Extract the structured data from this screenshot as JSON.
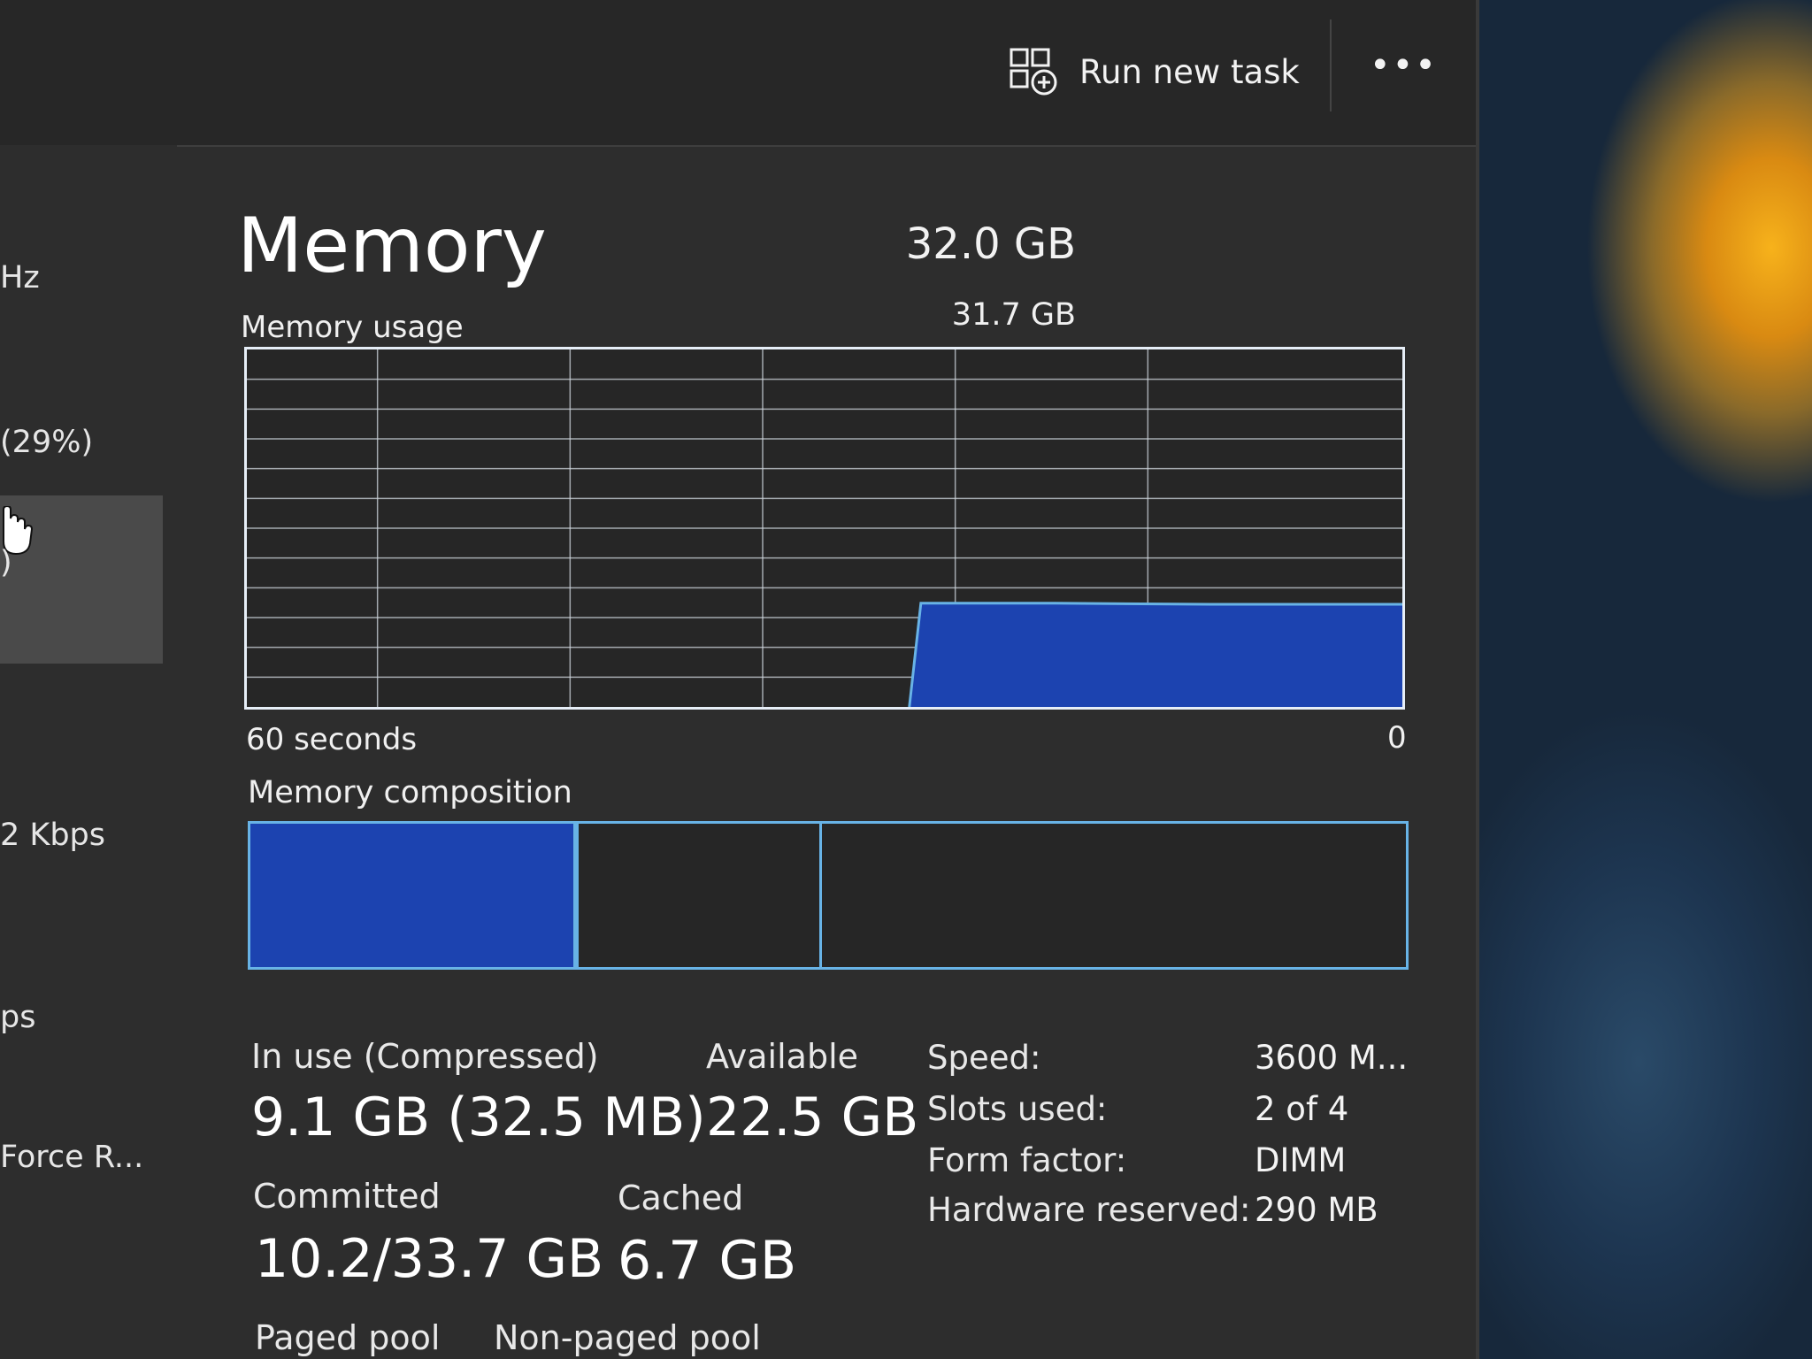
{
  "toolbar": {
    "run_new_task": "Run new task",
    "more": "•••"
  },
  "sidebar": {
    "items": [
      {
        "text": "Hz"
      },
      {
        "text": "(29%)"
      },
      {
        "text": ")"
      },
      {
        "text": "2 Kbps"
      },
      {
        "text": "ps"
      },
      {
        "text": "Force R..."
      }
    ]
  },
  "memory": {
    "title": "Memory",
    "total": "32.0 GB",
    "usage_label": "Memory usage",
    "usage_max": "31.7 GB",
    "axis_left": "60 seconds",
    "axis_right": "0",
    "composition_label": "Memory composition"
  },
  "chart_data": {
    "type": "area",
    "title": "Memory usage",
    "x_range_seconds": [
      60,
      0
    ],
    "ylim": [
      0,
      31.7
    ],
    "y_unit": "GB",
    "grid": true,
    "series": [
      {
        "values": [
          {
            "seconds_ago": 60,
            "gb": null
          },
          {
            "seconds_ago": 26,
            "gb": null
          },
          {
            "seconds_ago": 25.6,
            "gb": 0
          },
          {
            "seconds_ago": 25,
            "gb": 9.2
          },
          {
            "seconds_ago": 18,
            "gb": 9.2
          },
          {
            "seconds_ago": 10,
            "gb": 9.1
          },
          {
            "seconds_ago": 0,
            "gb": 9.1
          }
        ]
      }
    ],
    "composition": {
      "in_use_fraction": 0.284,
      "standby_end_fraction": 0.495
    },
    "colors": {
      "fill": "#1c43b0",
      "line": "#68b3e6",
      "grid": "#cfd6dd"
    }
  },
  "stats": {
    "in_use_label": "In use (Compressed)",
    "in_use_value": "9.1 GB (32.5 MB)",
    "available_label": "Available",
    "available_value": "22.5 GB",
    "committed_label": "Committed",
    "committed_value": "10.2/33.7 GB",
    "cached_label": "Cached",
    "cached_value": "6.7 GB",
    "paged_pool_label": "Paged pool",
    "non_paged_pool_label": "Non-paged pool"
  },
  "hardware": {
    "speed_label": "Speed:",
    "speed_value": "3600 M...",
    "slots_label": "Slots used:",
    "slots_value": "2 of 4",
    "form_factor_label": "Form factor:",
    "form_factor_value": "DIMM",
    "reserved_label": "Hardware reserved:",
    "reserved_value": "290 MB"
  }
}
